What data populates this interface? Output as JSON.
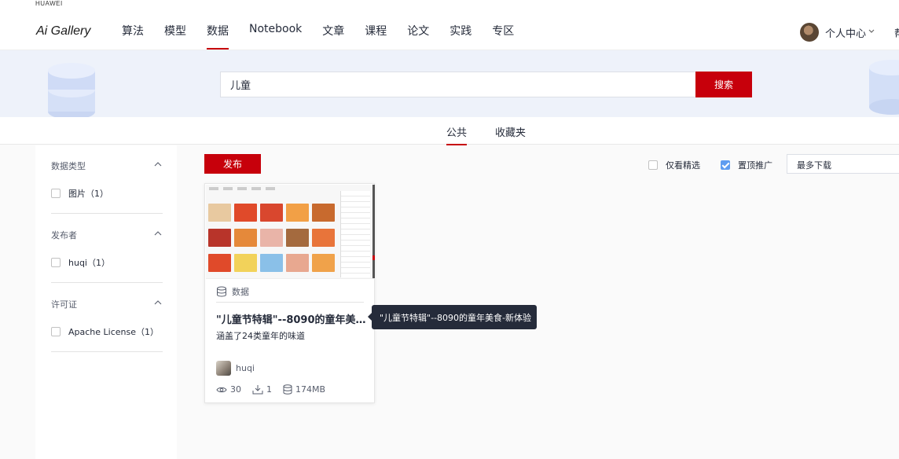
{
  "brand": {
    "company": "HUAWEI",
    "product": "Ai Gallery"
  },
  "nav": {
    "items": [
      {
        "label": "算法"
      },
      {
        "label": "模型"
      },
      {
        "label": "数据"
      },
      {
        "label": "Notebook"
      },
      {
        "label": "文章"
      },
      {
        "label": "课程"
      },
      {
        "label": "论文"
      },
      {
        "label": "实践"
      },
      {
        "label": "专区"
      }
    ],
    "active": "数据"
  },
  "user": {
    "label": "个人中心",
    "edge_text": "帮"
  },
  "search": {
    "value": "儿童",
    "button_label": "搜索"
  },
  "tabs": [
    {
      "label": "公共"
    },
    {
      "label": "收藏夹"
    }
  ],
  "sidebar": {
    "sections": [
      {
        "title": "数据类型",
        "options": [
          {
            "label": "图片（1）"
          }
        ]
      },
      {
        "title": "发布者",
        "options": [
          {
            "label": "huqi（1）"
          }
        ]
      },
      {
        "title": "许可证",
        "options": [
          {
            "label": "Apache License（1）"
          }
        ]
      }
    ]
  },
  "toolbar": {
    "publish_label": "发布",
    "filter_featured": "仅看精选",
    "filter_pinned": "置顶推广",
    "filter_pinned_checked": true,
    "sort_selected": "最多下载"
  },
  "card": {
    "type_label": "数据",
    "title": "\"儿童节特辑\"--8090的童年美食-新体验",
    "description": "涵盖了24类童年的味道",
    "author": "huqi",
    "views": "30",
    "downloads": "1",
    "size": "174MB"
  },
  "tooltip": {
    "text": "\"儿童节特辑\"--8090的童年美食-新体验"
  },
  "colors": {
    "accent": "#c7000b",
    "checkbox_checked": "#5e9cf0",
    "banner_bg": "#eef2fa"
  }
}
